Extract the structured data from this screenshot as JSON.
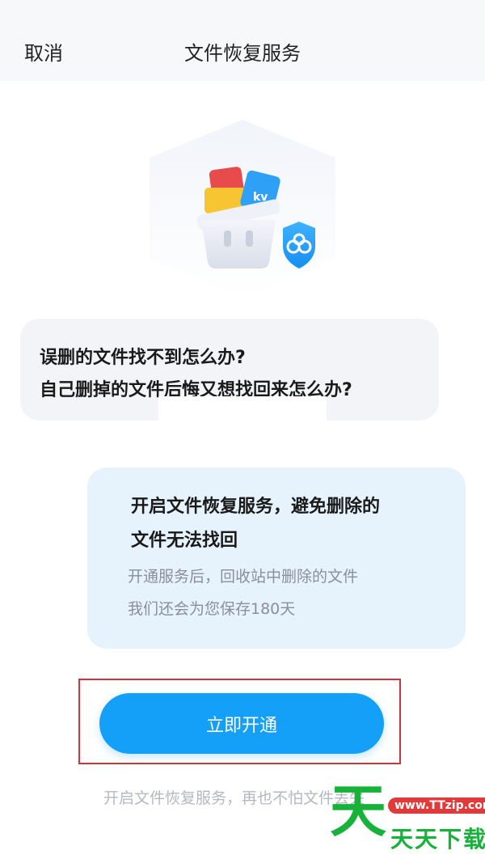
{
  "header": {
    "cancel_label": "取消",
    "title": "文件恢复服务"
  },
  "illustration": {
    "icon": "trash-bin-recovery-illustration",
    "badge_icon": "cloud-shield-icon"
  },
  "question": {
    "line1": "误删的文件找不到怎么办?",
    "line2": "自己删掉的文件后悔又想找回来怎么办?"
  },
  "answer": {
    "heading_line1": "开启文件恢复服务，避免删除的",
    "heading_line2": "文件无法找回",
    "desc_line1": "开通服务后，回收站中删除的文件",
    "desc_line2": "我们还会为您保存180天"
  },
  "cta": {
    "label": "立即开通"
  },
  "footer": {
    "note": "开启文件恢复服务，再也不怕文件丢失"
  },
  "watermark": {
    "big_char": "天",
    "url": "www.TTzip.com",
    "text": "天天下载"
  },
  "colors": {
    "accent": "#14a0f8",
    "answer_bg": "#e6f3fd",
    "question_bg": "#f3f4f7",
    "highlight": "#d0343a",
    "watermark_green": "#17b23a"
  }
}
